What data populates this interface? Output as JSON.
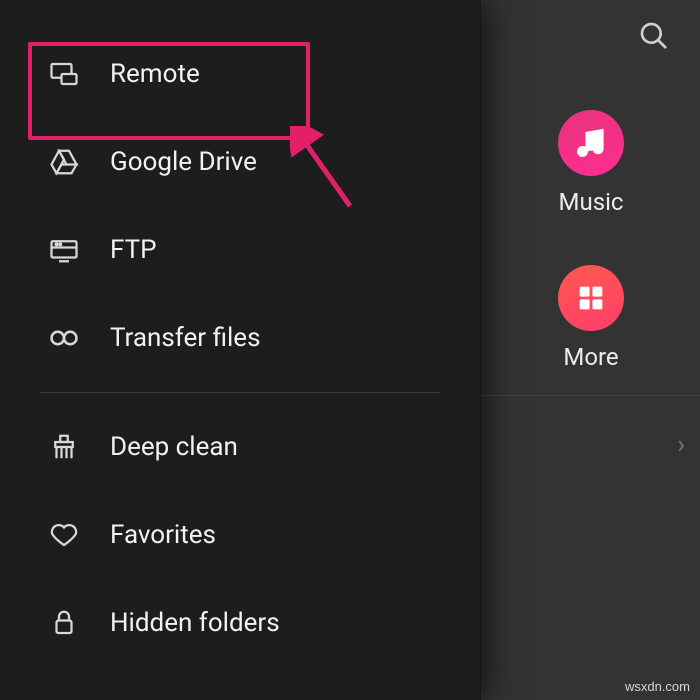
{
  "drawer": {
    "items": [
      {
        "key": "remote",
        "label": "Remote"
      },
      {
        "key": "google-drive",
        "label": "Google Drive"
      },
      {
        "key": "ftp",
        "label": "FTP"
      },
      {
        "key": "transfer-files",
        "label": "Transfer files"
      },
      {
        "key": "deep-clean",
        "label": "Deep clean"
      },
      {
        "key": "favorites",
        "label": "Favorites"
      },
      {
        "key": "hidden-folders",
        "label": "Hidden folders"
      }
    ]
  },
  "main": {
    "categories": {
      "music": {
        "label": "Music"
      },
      "more": {
        "label": "More"
      }
    }
  },
  "annotation": {
    "highlight_color": "#e2206a"
  },
  "watermark": "wsxdn.com"
}
